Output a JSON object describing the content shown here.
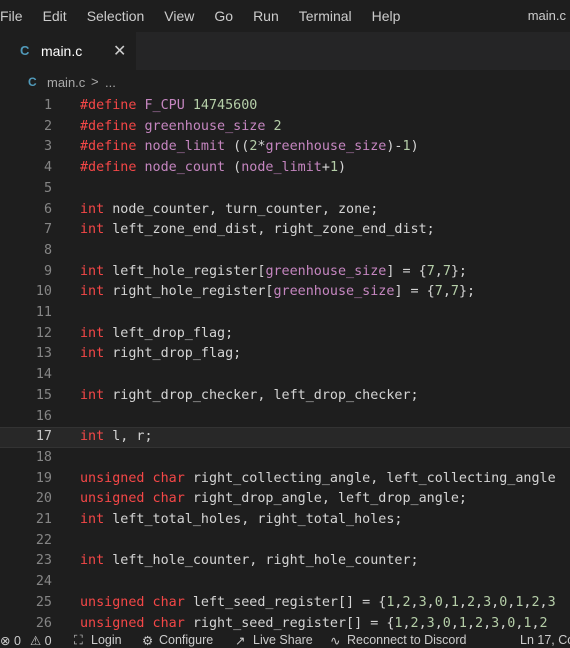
{
  "menu": [
    "File",
    "Edit",
    "Selection",
    "View",
    "Go",
    "Run",
    "Terminal",
    "Help"
  ],
  "window_title": "main.c",
  "tab": {
    "label": "main.c",
    "close": "✕",
    "icon": "C"
  },
  "breadcrumb": {
    "icon": "C",
    "file": "main.c",
    "sep": ">",
    "more": "..."
  },
  "current_line": 17,
  "code_lines": [
    {
      "n": "1",
      "html": "<span class='pp'>#define</span> <span class='mac'>F_CPU</span> <span class='num'>14745600</span>"
    },
    {
      "n": "2",
      "html": "<span class='pp'>#define</span> <span class='mac'>greenhouse_size</span> <span class='num'>2</span>"
    },
    {
      "n": "3",
      "html": "<span class='pp'>#define</span> <span class='mac'>node_limit</span> ((<span class='num'>2</span>*<span class='mac'>greenhouse_size</span>)-<span class='num'>1</span>)"
    },
    {
      "n": "4",
      "html": "<span class='pp'>#define</span> <span class='mac'>node_count</span> (<span class='mac'>node_limit</span>+<span class='num'>1</span>)"
    },
    {
      "n": "5",
      "html": ""
    },
    {
      "n": "6",
      "html": "<span class='k'>int</span> node_counter, turn_counter, zone;"
    },
    {
      "n": "7",
      "html": "<span class='k'>int</span> left_zone_end_dist, right_zone_end_dist;"
    },
    {
      "n": "8",
      "html": ""
    },
    {
      "n": "9",
      "html": "<span class='k'>int</span> left_hole_register[<span class='mac'>greenhouse_size</span>] = {<span class='num'>7</span>,<span class='num'>7</span>};"
    },
    {
      "n": "10",
      "html": "<span class='k'>int</span> right_hole_register[<span class='mac'>greenhouse_size</span>] = {<span class='num'>7</span>,<span class='num'>7</span>};"
    },
    {
      "n": "11",
      "html": ""
    },
    {
      "n": "12",
      "html": "<span class='k'>int</span> left_drop_flag;"
    },
    {
      "n": "13",
      "html": "<span class='k'>int</span> right_drop_flag;"
    },
    {
      "n": "14",
      "html": ""
    },
    {
      "n": "15",
      "html": "<span class='k'>int</span> right_drop_checker, left_drop_checker;"
    },
    {
      "n": "16",
      "html": ""
    },
    {
      "n": "17",
      "html": "<span class='k'>int</span> l, r;"
    },
    {
      "n": "18",
      "html": ""
    },
    {
      "n": "19",
      "html": "<span class='k'>unsigned char</span> right_collecting_angle, left_collecting_angle"
    },
    {
      "n": "20",
      "html": "<span class='k'>unsigned char</span> right_drop_angle, left_drop_angle;"
    },
    {
      "n": "21",
      "html": "<span class='k'>int</span> left_total_holes, right_total_holes;"
    },
    {
      "n": "22",
      "html": ""
    },
    {
      "n": "23",
      "html": "<span class='k'>int</span> left_hole_counter, right_hole_counter;"
    },
    {
      "n": "24",
      "html": ""
    },
    {
      "n": "25",
      "html": "<span class='k'>unsigned char</span> left_seed_register[] = {<span class='num'>1</span>,<span class='num'>2</span>,<span class='num'>3</span>,<span class='num'>0</span>,<span class='num'>1</span>,<span class='num'>2</span>,<span class='num'>3</span>,<span class='num'>0</span>,<span class='num'>1</span>,<span class='num'>2</span>,<span class='num'>3</span>"
    },
    {
      "n": "26",
      "html": "<span class='k'>unsigned char</span> right_seed_register[] = {<span class='num'>1</span>,<span class='num'>2</span>,<span class='num'>3</span>,<span class='num'>0</span>,<span class='num'>1</span>,<span class='num'>2</span>,<span class='num'>3</span>,<span class='num'>0</span>,<span class='num'>1</span>,<span class='num'>2</span>"
    }
  ],
  "status": {
    "errors": "⊗ 0",
    "warnings": "⚠ 0",
    "login": "Login",
    "configure": "Configure",
    "live_share": "Live Share",
    "discord": "Reconnect to Discord",
    "position": "Ln 17, Co"
  },
  "colors": {
    "background": "#1e1e1e",
    "keyword": "#f44747",
    "macro": "#c586c0",
    "number": "#b5cea8"
  }
}
